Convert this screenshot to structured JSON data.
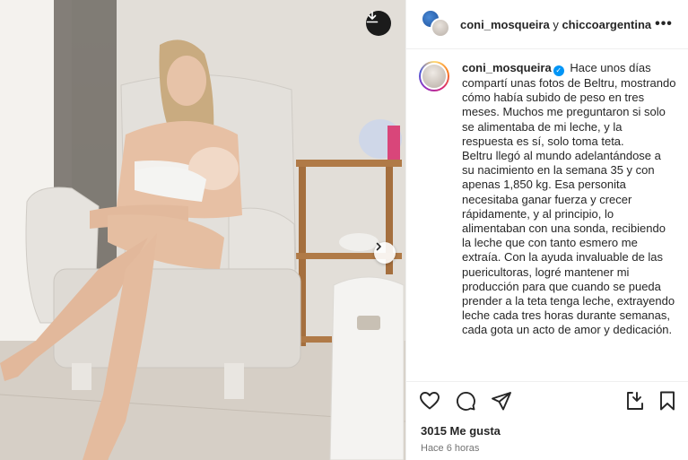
{
  "post": {
    "header": {
      "author": "coni_mosqueira",
      "connector": " y ",
      "collaborator": "chiccoargentina"
    },
    "caption": {
      "username": "coni_mosqueira",
      "verified_icon": "verified-badge-icon",
      "paragraph_1": "Hace unos días compartí unas fotos de Beltru, mostrando cómo había subido de peso en tres meses. Muchos me preguntaron si solo se alimentaba de mi leche, y la respuesta es sí, solo toma teta.",
      "paragraph_2": "Beltru llegó al mundo adelantándose a su nacimiento en la semana 35 y con apenas 1,850 kg. Esa personita necesitaba ganar fuerza y crecer rápidamente, y al principio, lo alimentaban con una sonda, recibiendo la leche que con tanto esmero me extraía. Con la ayuda invaluable de las puericultoras, logré mantener mi producción para que cuando se pueda prender a la teta tenga leche, extrayendo leche cada tres horas durante semanas, cada gota un acto de amor y dedicación."
    },
    "likes": "3015 Me gusta",
    "time": "Hace 6 horas",
    "icons": {
      "download": "download-icon",
      "next": "chevron-right-icon",
      "more": "more-options-icon",
      "like": "heart-icon",
      "comment": "comment-icon",
      "share": "share-icon",
      "save": "bookmark-icon"
    }
  },
  "colors": {
    "text": "#262626",
    "secondary": "#737373",
    "verified": "#0095f6",
    "border": "#efefef"
  }
}
